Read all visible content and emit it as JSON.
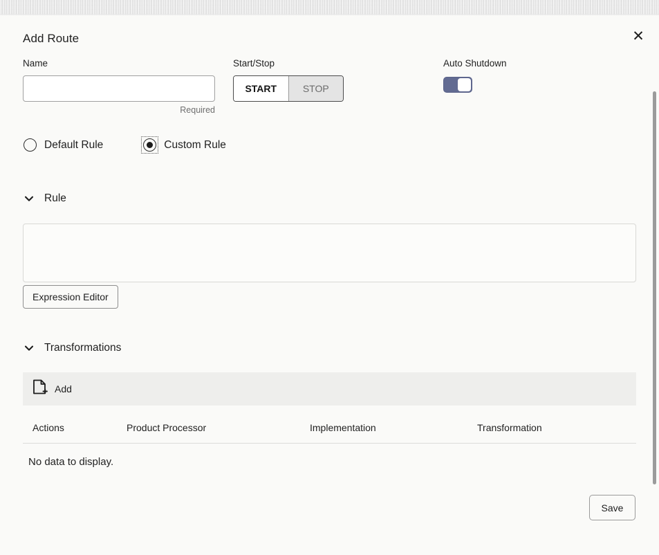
{
  "dialog": {
    "title": "Add Route",
    "close_label": "✕",
    "close_icon": "close-icon"
  },
  "form": {
    "name": {
      "label": "Name",
      "value": "",
      "placeholder": "",
      "helper": "Required"
    },
    "start_stop": {
      "label": "Start/Stop",
      "options": [
        "START",
        "STOP"
      ],
      "selected": "START"
    },
    "auto_shutdown": {
      "label": "Auto Shutdown",
      "state": "on",
      "accent_color": "#626b92"
    }
  },
  "rule_type": {
    "options": [
      {
        "label": "Default Rule",
        "selected": false,
        "focused": false
      },
      {
        "label": "Custom Rule",
        "selected": true,
        "focused": true
      }
    ]
  },
  "rule_section": {
    "title": "Rule",
    "chevron_icon": "chevron-down-icon",
    "expanded": true,
    "expression": {
      "value": "",
      "placeholder": ""
    },
    "expression_editor_button": "Expression Editor"
  },
  "transformations_section": {
    "title": "Transformations",
    "chevron_icon": "chevron-down-icon",
    "expanded": true,
    "add_row": {
      "label": "Add",
      "icon": "document-add-icon"
    },
    "table": {
      "columns": [
        "Actions",
        "Product Processor",
        "Implementation",
        "Transformation"
      ],
      "rows": [],
      "empty_message": "No data to display."
    }
  },
  "footer": {
    "save_label": "Save"
  },
  "scrollbar": {
    "orientation": "vertical",
    "thumb_color": "#9b9b9b"
  }
}
